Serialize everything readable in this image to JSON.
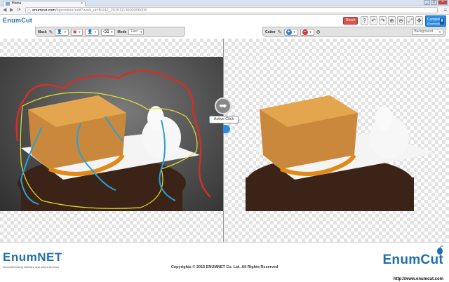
{
  "browser": {
    "tab_title": "Home",
    "tab_close": "×",
    "url_host": "enumcut.com",
    "url_path": "/bgcontour/edit?work_id=NU42_20151113000006008",
    "nav_back": "◀",
    "nav_forward": "▶",
    "nav_reload": "⟳",
    "menu_glyph": "≡",
    "win_min": "_",
    "win_max": "□",
    "win_close": "×"
  },
  "app": {
    "logo": "EnumCut",
    "reset_label": "Reset",
    "help_glyph": "?",
    "undo_glyph": "↶",
    "redo_glyph": "↷",
    "zoom_in_glyph": "⊕",
    "zoom_out_glyph": "⊖",
    "fit_glyph": "⤢",
    "move_glyph": "✥",
    "complete_label_line1": "Complete",
    "complete_label_line2": "(Download)",
    "download_glyph": "⬇"
  },
  "mask_toolbar": {
    "label": "Mask",
    "mode_label": "Mode",
    "mode_value": "Fast"
  },
  "cutter_toolbar": {
    "label": "Cutter",
    "add_glyph": "+",
    "remove_glyph": "−",
    "background_label": "Background"
  },
  "canvas": {
    "arrow_glyph": "➡",
    "tooltip": "Active Click"
  },
  "footer": {
    "left_logo": "EnumNET",
    "left_tagline": "Groundbreaking software and useful services",
    "copyright": "Copyrights © 2015 ENUMNET Co. Ltd. All Rights Reserved",
    "right_logo": "EnumCut",
    "right_url": "http://www.enumcut.com"
  },
  "colors": {
    "accent_blue": "#2a8be0",
    "reset_red": "#d9534f",
    "add_blue": "#2a7fd4",
    "remove_red": "#d43a3a",
    "stroke_red": "#d0302a",
    "stroke_blue": "#2aa0d8",
    "stroke_yellow": "#e4e12a"
  }
}
